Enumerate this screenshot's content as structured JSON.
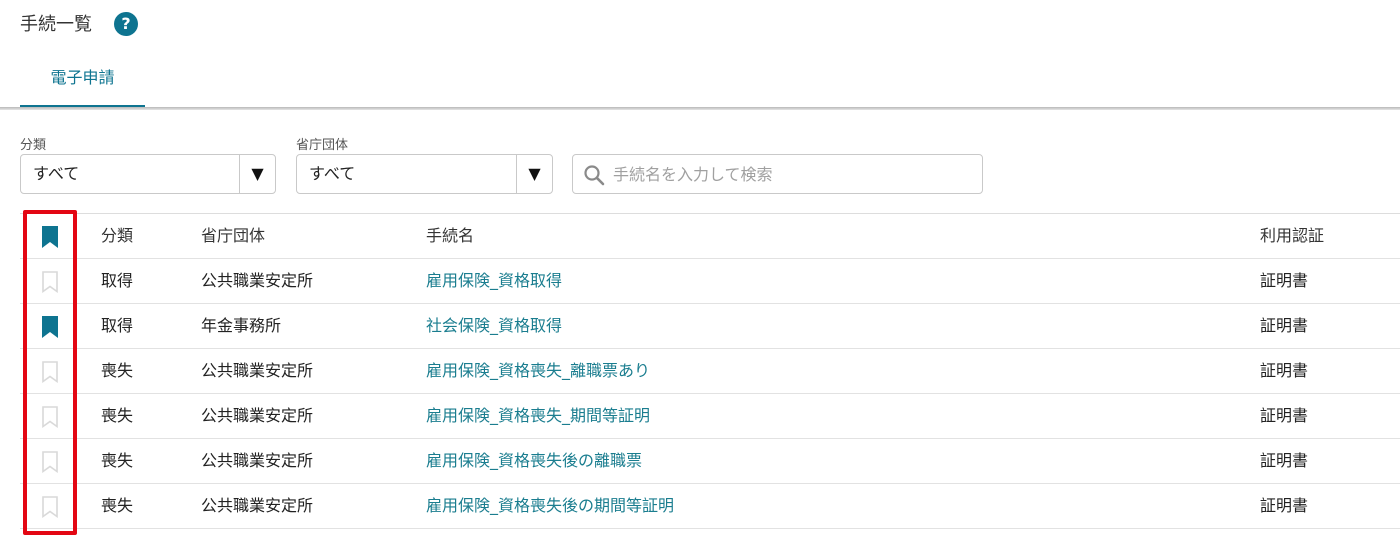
{
  "header": {
    "title": "手続一覧",
    "help_symbol": "?",
    "tabs": [
      {
        "label": "電子申請",
        "active": true
      }
    ]
  },
  "filters": {
    "category": {
      "label": "分類",
      "value": "すべて"
    },
    "agency": {
      "label": "省庁団体",
      "value": "すべて"
    },
    "search": {
      "placeholder": "手続名を入力して検索",
      "value": ""
    }
  },
  "table": {
    "headers": {
      "category": "分類",
      "agency": "省庁団体",
      "name": "手続名",
      "auth": "利用認証"
    },
    "header_bookmark_filled": true,
    "rows": [
      {
        "bookmarked": false,
        "category": "取得",
        "agency": "公共職業安定所",
        "name": "雇用保険_資格取得",
        "auth": "証明書"
      },
      {
        "bookmarked": true,
        "category": "取得",
        "agency": "年金事務所",
        "name": "社会保険_資格取得",
        "auth": "証明書"
      },
      {
        "bookmarked": false,
        "category": "喪失",
        "agency": "公共職業安定所",
        "name": "雇用保険_資格喪失_離職票あり",
        "auth": "証明書"
      },
      {
        "bookmarked": false,
        "category": "喪失",
        "agency": "公共職業安定所",
        "name": "雇用保険_資格喪失_期間等証明",
        "auth": "証明書"
      },
      {
        "bookmarked": false,
        "category": "喪失",
        "agency": "公共職業安定所",
        "name": "雇用保険_資格喪失後の離職票",
        "auth": "証明書"
      },
      {
        "bookmarked": false,
        "category": "喪失",
        "agency": "公共職業安定所",
        "name": "雇用保険_資格喪失後の期間等証明",
        "auth": "証明書"
      }
    ]
  },
  "colors": {
    "accent": "#0e7490",
    "link": "#1a7d8f",
    "bookmark_empty": "#d9d9d9",
    "highlight": "#e30613"
  },
  "icons": {
    "help": "help-circle-icon",
    "dropdown": "triangle-down-icon",
    "search": "search-icon",
    "bookmark": "bookmark-icon"
  }
}
